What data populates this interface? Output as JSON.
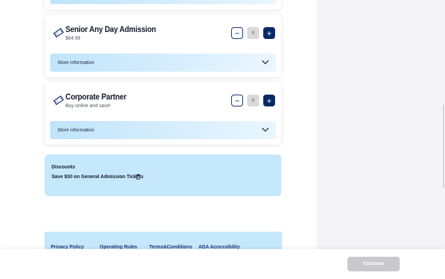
{
  "tickets": [
    {
      "title": "Senior Any Day Admission",
      "subtitle": "$64.99",
      "quantity": "0",
      "more_info_label": "More information",
      "minus_symbol": "−",
      "plus_symbol": "+"
    },
    {
      "title": "Corporate Partner",
      "subtitle": "Buy online and save!",
      "quantity": "0",
      "more_info_label": "More information",
      "minus_symbol": "−",
      "plus_symbol": "+"
    }
  ],
  "discounts": {
    "title": "Discounts",
    "item": "Save $30 on General Admission Tickets"
  },
  "footer": {
    "links": [
      "Privacy Policy",
      "Operating Rules",
      "Terms&Conditions",
      "ADA Accessibility"
    ]
  },
  "checkout": {
    "continue_label": "Continue"
  },
  "colors": {
    "primary": "#0a2a66",
    "accent_light": "#c6e8fc",
    "disabled": "#c9c9cb"
  },
  "icons": [
    "ticket-icon",
    "chevron-down-icon",
    "trash-icon"
  ]
}
